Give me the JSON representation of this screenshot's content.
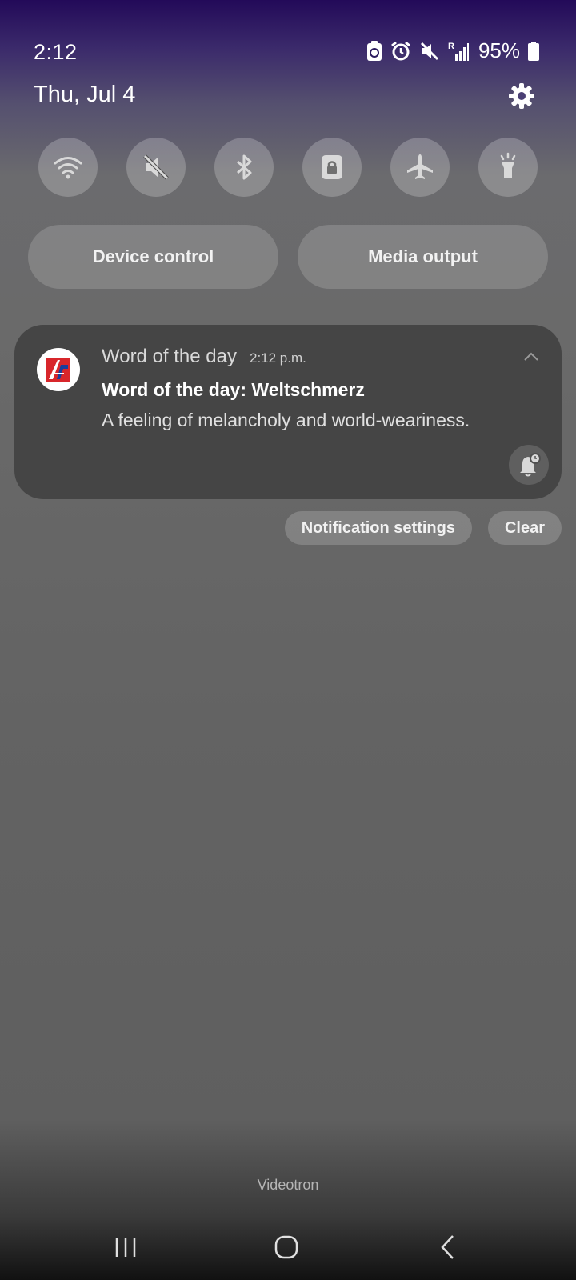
{
  "status_bar": {
    "time": "2:12",
    "battery_percent": "95%",
    "icons": [
      "battery-saver-icon",
      "alarm-icon",
      "mute-icon",
      "signal-roaming-icon",
      "battery-icon"
    ]
  },
  "date": "Thu, Jul 4",
  "quick_settings": {
    "tiles": [
      "wifi-icon",
      "sound-off-icon",
      "bluetooth-icon",
      "screen-lock-icon",
      "airplane-mode-icon",
      "flashlight-icon"
    ],
    "device_control_label": "Device control",
    "media_output_label": "Media output"
  },
  "notification": {
    "app_name": "Word of the day",
    "time": "2:12 p.m.",
    "title": "Word of the day: Weltschmerz",
    "body": "A feeling of melancholy and world-weariness.",
    "icon": "word-of-the-day-app-icon"
  },
  "notification_actions": {
    "settings_label": "Notification settings",
    "clear_label": "Clear"
  },
  "carrier": "Videotron",
  "colors": {
    "card_bg": "#454545",
    "app_icon_red": "#d8262b",
    "app_icon_blue": "#1a3d9c"
  }
}
